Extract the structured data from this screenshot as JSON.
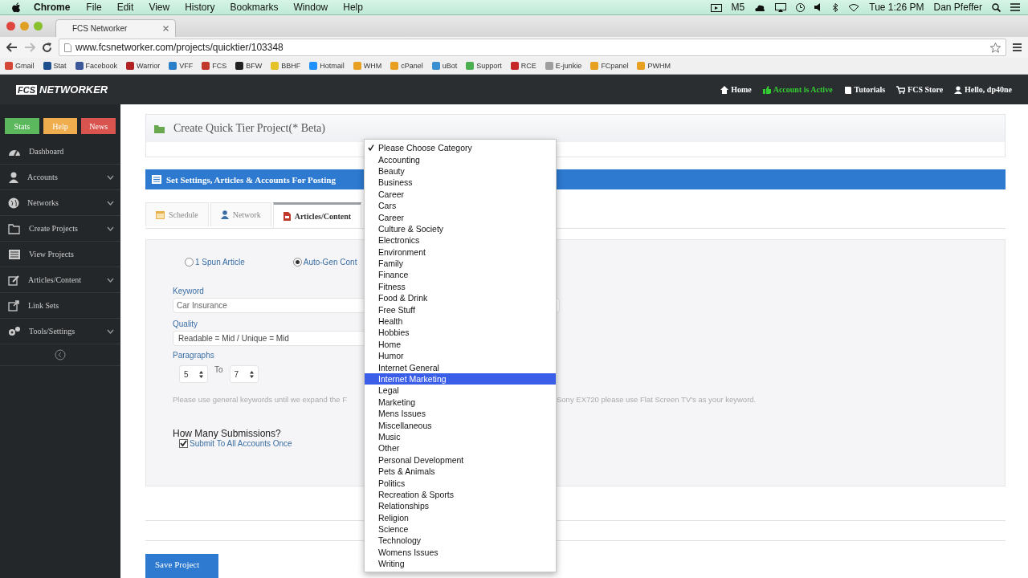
{
  "menubar": {
    "app": "Chrome",
    "menus": [
      "File",
      "Edit",
      "View",
      "History",
      "Bookmarks",
      "Window",
      "Help"
    ],
    "status_text": "M5",
    "clock": "Tue 1:26 PM",
    "user": "Dan Pfeffer"
  },
  "browser": {
    "tab_title": "FCS Networker",
    "url": "www.fcsnetworker.com/projects/quicktier/103348",
    "bookmarks": [
      {
        "label": "Gmail",
        "color": "#d44638"
      },
      {
        "label": "Stat",
        "color": "#1f4e8c"
      },
      {
        "label": "Facebook",
        "color": "#3b5998"
      },
      {
        "label": "Warrior",
        "color": "#b22222"
      },
      {
        "label": "VFF",
        "color": "#2a7fc9"
      },
      {
        "label": "FCS",
        "color": "#c0392b"
      },
      {
        "label": "BFW",
        "color": "#222222"
      },
      {
        "label": "BBHF",
        "color": "#e6c229"
      },
      {
        "label": "Hotmail",
        "color": "#1e90ff"
      },
      {
        "label": "WHM",
        "color": "#e8a020"
      },
      {
        "label": "cPanel",
        "color": "#e8a020"
      },
      {
        "label": "uBot",
        "color": "#3a8fd0"
      },
      {
        "label": "Support",
        "color": "#4caf50"
      },
      {
        "label": "RCE",
        "color": "#c62828"
      },
      {
        "label": "E-junkie",
        "color": "#9e9e9e"
      },
      {
        "label": "FCpanel",
        "color": "#e8a020"
      },
      {
        "label": "PWHM",
        "color": "#e8a020"
      }
    ]
  },
  "navbar": {
    "logo_box": "FCS",
    "logo_text": "NETWORKER",
    "links": [
      {
        "label": "Home",
        "color": "#ffffff"
      },
      {
        "label": "Account is Active",
        "color": "#33cc33"
      },
      {
        "label": "Tutorials",
        "color": "#ffffff"
      },
      {
        "label": "FCS Store",
        "color": "#ffffff"
      },
      {
        "label": "Hello, dp40ne",
        "color": "#ffffff"
      }
    ]
  },
  "sidebar": {
    "buttons": [
      {
        "label": "Stats",
        "color": "#5cb85c"
      },
      {
        "label": "Help",
        "color": "#f0ad4e"
      },
      {
        "label": "News",
        "color": "#d9534f"
      }
    ],
    "items": [
      {
        "label": "Dashboard",
        "expandable": false
      },
      {
        "label": "Accounts",
        "expandable": true
      },
      {
        "label": "Networks",
        "expandable": true
      },
      {
        "label": "Create Projects",
        "expandable": true
      },
      {
        "label": "View Projects",
        "expandable": false
      },
      {
        "label": "Articles/Content",
        "expandable": true
      },
      {
        "label": "Link Sets",
        "expandable": false
      },
      {
        "label": "Tools/Settings",
        "expandable": true
      }
    ]
  },
  "page": {
    "title": "Create Quick Tier Project(* Beta)",
    "section_title": "Set Settings, Articles & Accounts For Posting",
    "tabs": [
      {
        "label": "Schedule",
        "selected": false
      },
      {
        "label": "Network",
        "selected": false
      },
      {
        "label": "Articles/Content",
        "selected": true
      }
    ],
    "content_options": [
      {
        "label": "1 Spun Article",
        "selected": false
      },
      {
        "label": "Auto-Gen Cont",
        "selected": true
      }
    ],
    "keyword": {
      "label": "Keyword",
      "value": "Car Insurance"
    },
    "quality": {
      "label": "Quality",
      "value": "Readable = Mid / Unique = Mid"
    },
    "paragraphs": {
      "label": "Paragraphs",
      "from": "5",
      "separator": "To",
      "to": "7"
    },
    "help_text_start": "Please use general keywords until we expand the F",
    "help_text_end": "Sony EX720 please use Flat Screen TV's as your keyword.",
    "submissions": {
      "label": "How Many Submissions?",
      "option": "Submit To All Accounts Once",
      "checked": true
    },
    "save_button": "Save Project"
  },
  "category_menu": {
    "items": [
      {
        "label": "Please Choose Category",
        "selected": true,
        "highlighted": false
      },
      {
        "label": "Accounting",
        "selected": false,
        "highlighted": false
      },
      {
        "label": "Beauty",
        "selected": false,
        "highlighted": false
      },
      {
        "label": "Business",
        "selected": false,
        "highlighted": false
      },
      {
        "label": "Career",
        "selected": false,
        "highlighted": false
      },
      {
        "label": "Cars",
        "selected": false,
        "highlighted": false
      },
      {
        "label": "Career",
        "selected": false,
        "highlighted": false
      },
      {
        "label": "Culture & Society",
        "selected": false,
        "highlighted": false
      },
      {
        "label": "Electronics",
        "selected": false,
        "highlighted": false
      },
      {
        "label": "Environment",
        "selected": false,
        "highlighted": false
      },
      {
        "label": "Family",
        "selected": false,
        "highlighted": false
      },
      {
        "label": "Finance",
        "selected": false,
        "highlighted": false
      },
      {
        "label": "Fitness",
        "selected": false,
        "highlighted": false
      },
      {
        "label": "Food & Drink",
        "selected": false,
        "highlighted": false
      },
      {
        "label": "Free Stuff",
        "selected": false,
        "highlighted": false
      },
      {
        "label": "Health",
        "selected": false,
        "highlighted": false
      },
      {
        "label": "Hobbies",
        "selected": false,
        "highlighted": false
      },
      {
        "label": "Home",
        "selected": false,
        "highlighted": false
      },
      {
        "label": "Humor",
        "selected": false,
        "highlighted": false
      },
      {
        "label": "Internet General",
        "selected": false,
        "highlighted": false
      },
      {
        "label": "Internet Marketing",
        "selected": false,
        "highlighted": true
      },
      {
        "label": "Legal",
        "selected": false,
        "highlighted": false
      },
      {
        "label": "Marketing",
        "selected": false,
        "highlighted": false
      },
      {
        "label": "Mens Issues",
        "selected": false,
        "highlighted": false
      },
      {
        "label": "Miscellaneous",
        "selected": false,
        "highlighted": false
      },
      {
        "label": "Music",
        "selected": false,
        "highlighted": false
      },
      {
        "label": "Other",
        "selected": false,
        "highlighted": false
      },
      {
        "label": "Personal Development",
        "selected": false,
        "highlighted": false
      },
      {
        "label": "Pets & Animals",
        "selected": false,
        "highlighted": false
      },
      {
        "label": "Politics",
        "selected": false,
        "highlighted": false
      },
      {
        "label": "Recreation & Sports",
        "selected": false,
        "highlighted": false
      },
      {
        "label": "Relationships",
        "selected": false,
        "highlighted": false
      },
      {
        "label": "Religion",
        "selected": false,
        "highlighted": false
      },
      {
        "label": "Science",
        "selected": false,
        "highlighted": false
      },
      {
        "label": "Technology",
        "selected": false,
        "highlighted": false
      },
      {
        "label": "Womens Issues",
        "selected": false,
        "highlighted": false
      },
      {
        "label": "Writing",
        "selected": false,
        "highlighted": false
      }
    ]
  }
}
